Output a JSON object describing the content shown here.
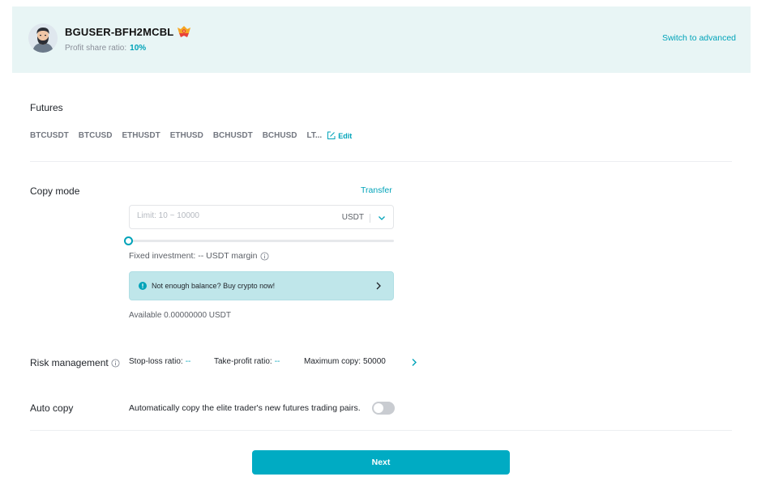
{
  "header": {
    "username": "BGUSER-BFH2MCBL",
    "profit_share_label": "Profit share ratio:",
    "profit_share_value": "10%",
    "switch_advanced": "Switch to advanced",
    "avatar_icon": "bearded-man-avatar",
    "badge_icon": "elite-trader-badge-icon"
  },
  "futures": {
    "title": "Futures",
    "pairs": [
      "BTCUSDT",
      "BTCUSD",
      "ETHUSDT",
      "ETHUSD",
      "BCHUSDT",
      "BCHUSD",
      "LT..."
    ],
    "edit_label": "Edit"
  },
  "copy_mode": {
    "title": "Copy mode",
    "transfer": "Transfer",
    "amount_placeholder": "Limit: 10 ~ 10000",
    "amount_value": "",
    "currency": "USDT",
    "slider_value_percent": 0,
    "fixed_investment": "Fixed investment: -- USDT margin",
    "banner_text": "Not enough balance? Buy crypto now!",
    "available": "Available 0.00000000 USDT"
  },
  "risk": {
    "title": "Risk management",
    "stop_loss_label": "Stop-loss ratio:",
    "stop_loss_value": "--",
    "take_profit_label": "Take-profit ratio:",
    "take_profit_value": "--",
    "max_copy_label": "Maximum copy:",
    "max_copy_value": "50000"
  },
  "auto_copy": {
    "title": "Auto copy",
    "description": "Automatically copy the elite trader's new futures trading pairs.",
    "enabled": false
  },
  "next_label": "Next",
  "colors": {
    "accent": "#00a3b9",
    "header_bg": "#e8f5f5",
    "banner_bg": "#bfe6ea",
    "button_bg": "#00abc3"
  }
}
